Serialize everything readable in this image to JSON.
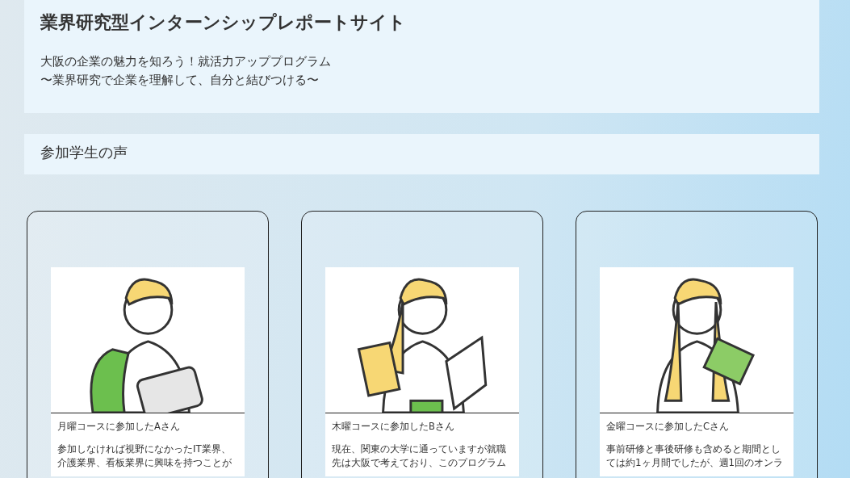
{
  "header": {
    "title": "業界研究型インターンシップレポートサイト",
    "subtitle_lines": [
      "大阪の企業の魅力を知ろう！就活力アッププログラム",
      "〜業界研究で企業を理解して、自分と結びつける〜"
    ]
  },
  "section": {
    "heading": "参加学生の声"
  },
  "testimonials": [
    {
      "kind": "backpack",
      "name": "月曜コースに参加したAさん",
      "body_lines": [
        "参加しなければ視野になかったIT業界、",
        "介護業界、看板業界に興味を持つことが"
      ]
    },
    {
      "kind": "books",
      "name": "木曜コースに参加したBさん",
      "body_lines": [
        "現在、関東の大学に通っていますが就職",
        "先は大阪で考えており、このプログラム"
      ]
    },
    {
      "kind": "folder",
      "name": "金曜コースに参加したCさん",
      "body_lines": [
        "事前研修と事後研修も含めると期間とし",
        "ては約1ヶ月間でしたが、週1回のオンラ"
      ]
    }
  ]
}
